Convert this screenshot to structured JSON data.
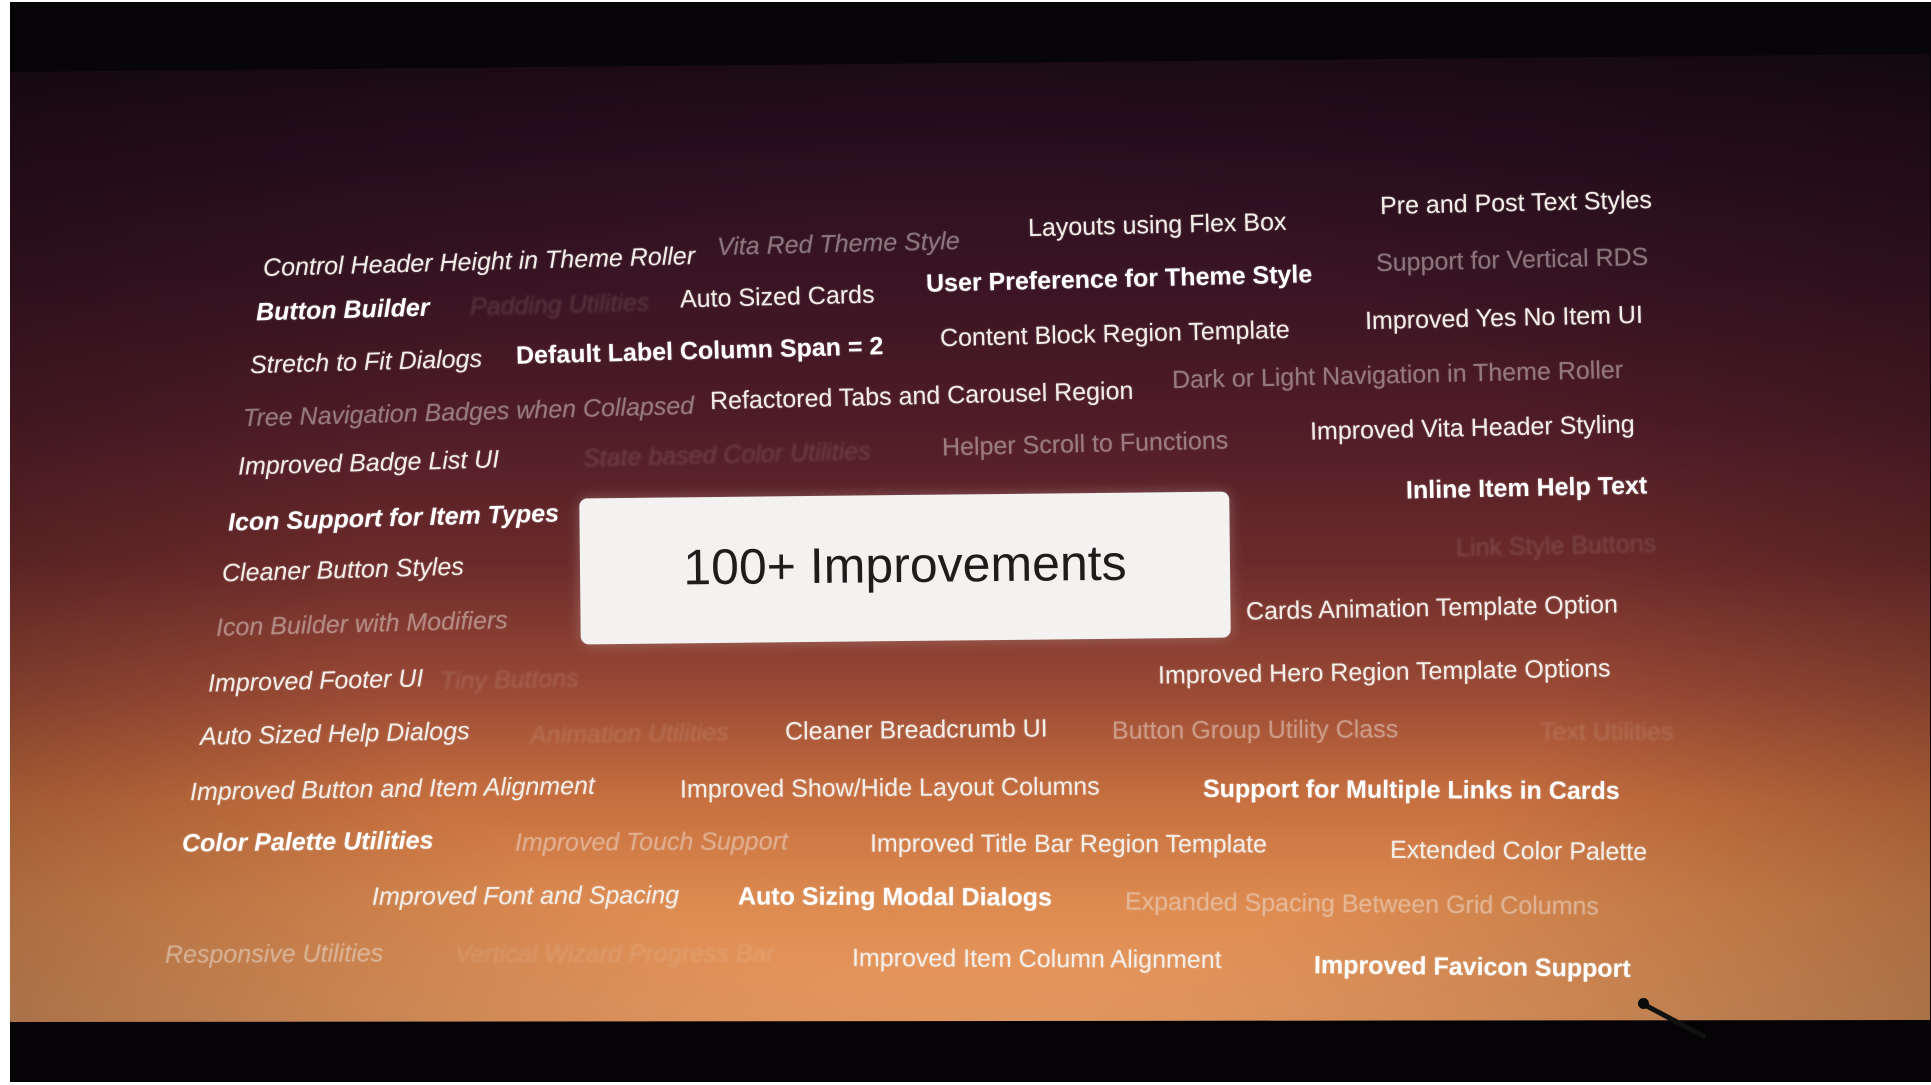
{
  "headline": "100+ Improvements",
  "features": [
    "Control Header Height in Theme Roller",
    "Vita Red Theme Style",
    "Layouts using Flex Box",
    "Pre and Post Text Styles",
    "Button Builder",
    "Padding Utilities",
    "Auto Sized Cards",
    "User Preference for Theme Style",
    "Support for Vertical RDS",
    "Stretch to Fit Dialogs",
    "Default Label Column Span = 2",
    "Content Block Region Template",
    "Improved Yes No Item UI",
    "Tree Navigation Badges when Collapsed",
    "Refactored Tabs and Carousel Region",
    "Dark or Light Navigation in Theme Roller",
    "Improved Badge List UI",
    "State based Color Utilities",
    "Helper Scroll to Functions",
    "Improved Vita Header Styling",
    "Icon Support for Item Types",
    "Inline Item Help Text",
    "Link Style Buttons",
    "Cleaner Button Styles",
    "Icon Builder with Modifiers",
    "Cards Animation Template Option",
    "Improved Footer UI",
    "Tiny Buttons",
    "Improved Hero Region Template Options",
    "Auto Sized Help Dialogs",
    "Animation Utilities",
    "Cleaner Breadcrumb UI",
    "Button Group Utility Class",
    "Text Utilities",
    "Improved Button and Item Alignment",
    "Improved Show/Hide Layout Columns",
    "Support for Multiple Links in Cards",
    "Color Palette Utilities",
    "Improved Touch Support",
    "Improved Title Bar Region Template",
    "Extended Color Palette",
    "Improved Font and Spacing",
    "Auto Sizing Modal Dialogs",
    "Expanded Spacing Between Grid Columns",
    "Responsive Utilities",
    "Vertical Wizard Progress Bar",
    "Improved Item Column Alignment",
    "Improved Favicon Support"
  ]
}
